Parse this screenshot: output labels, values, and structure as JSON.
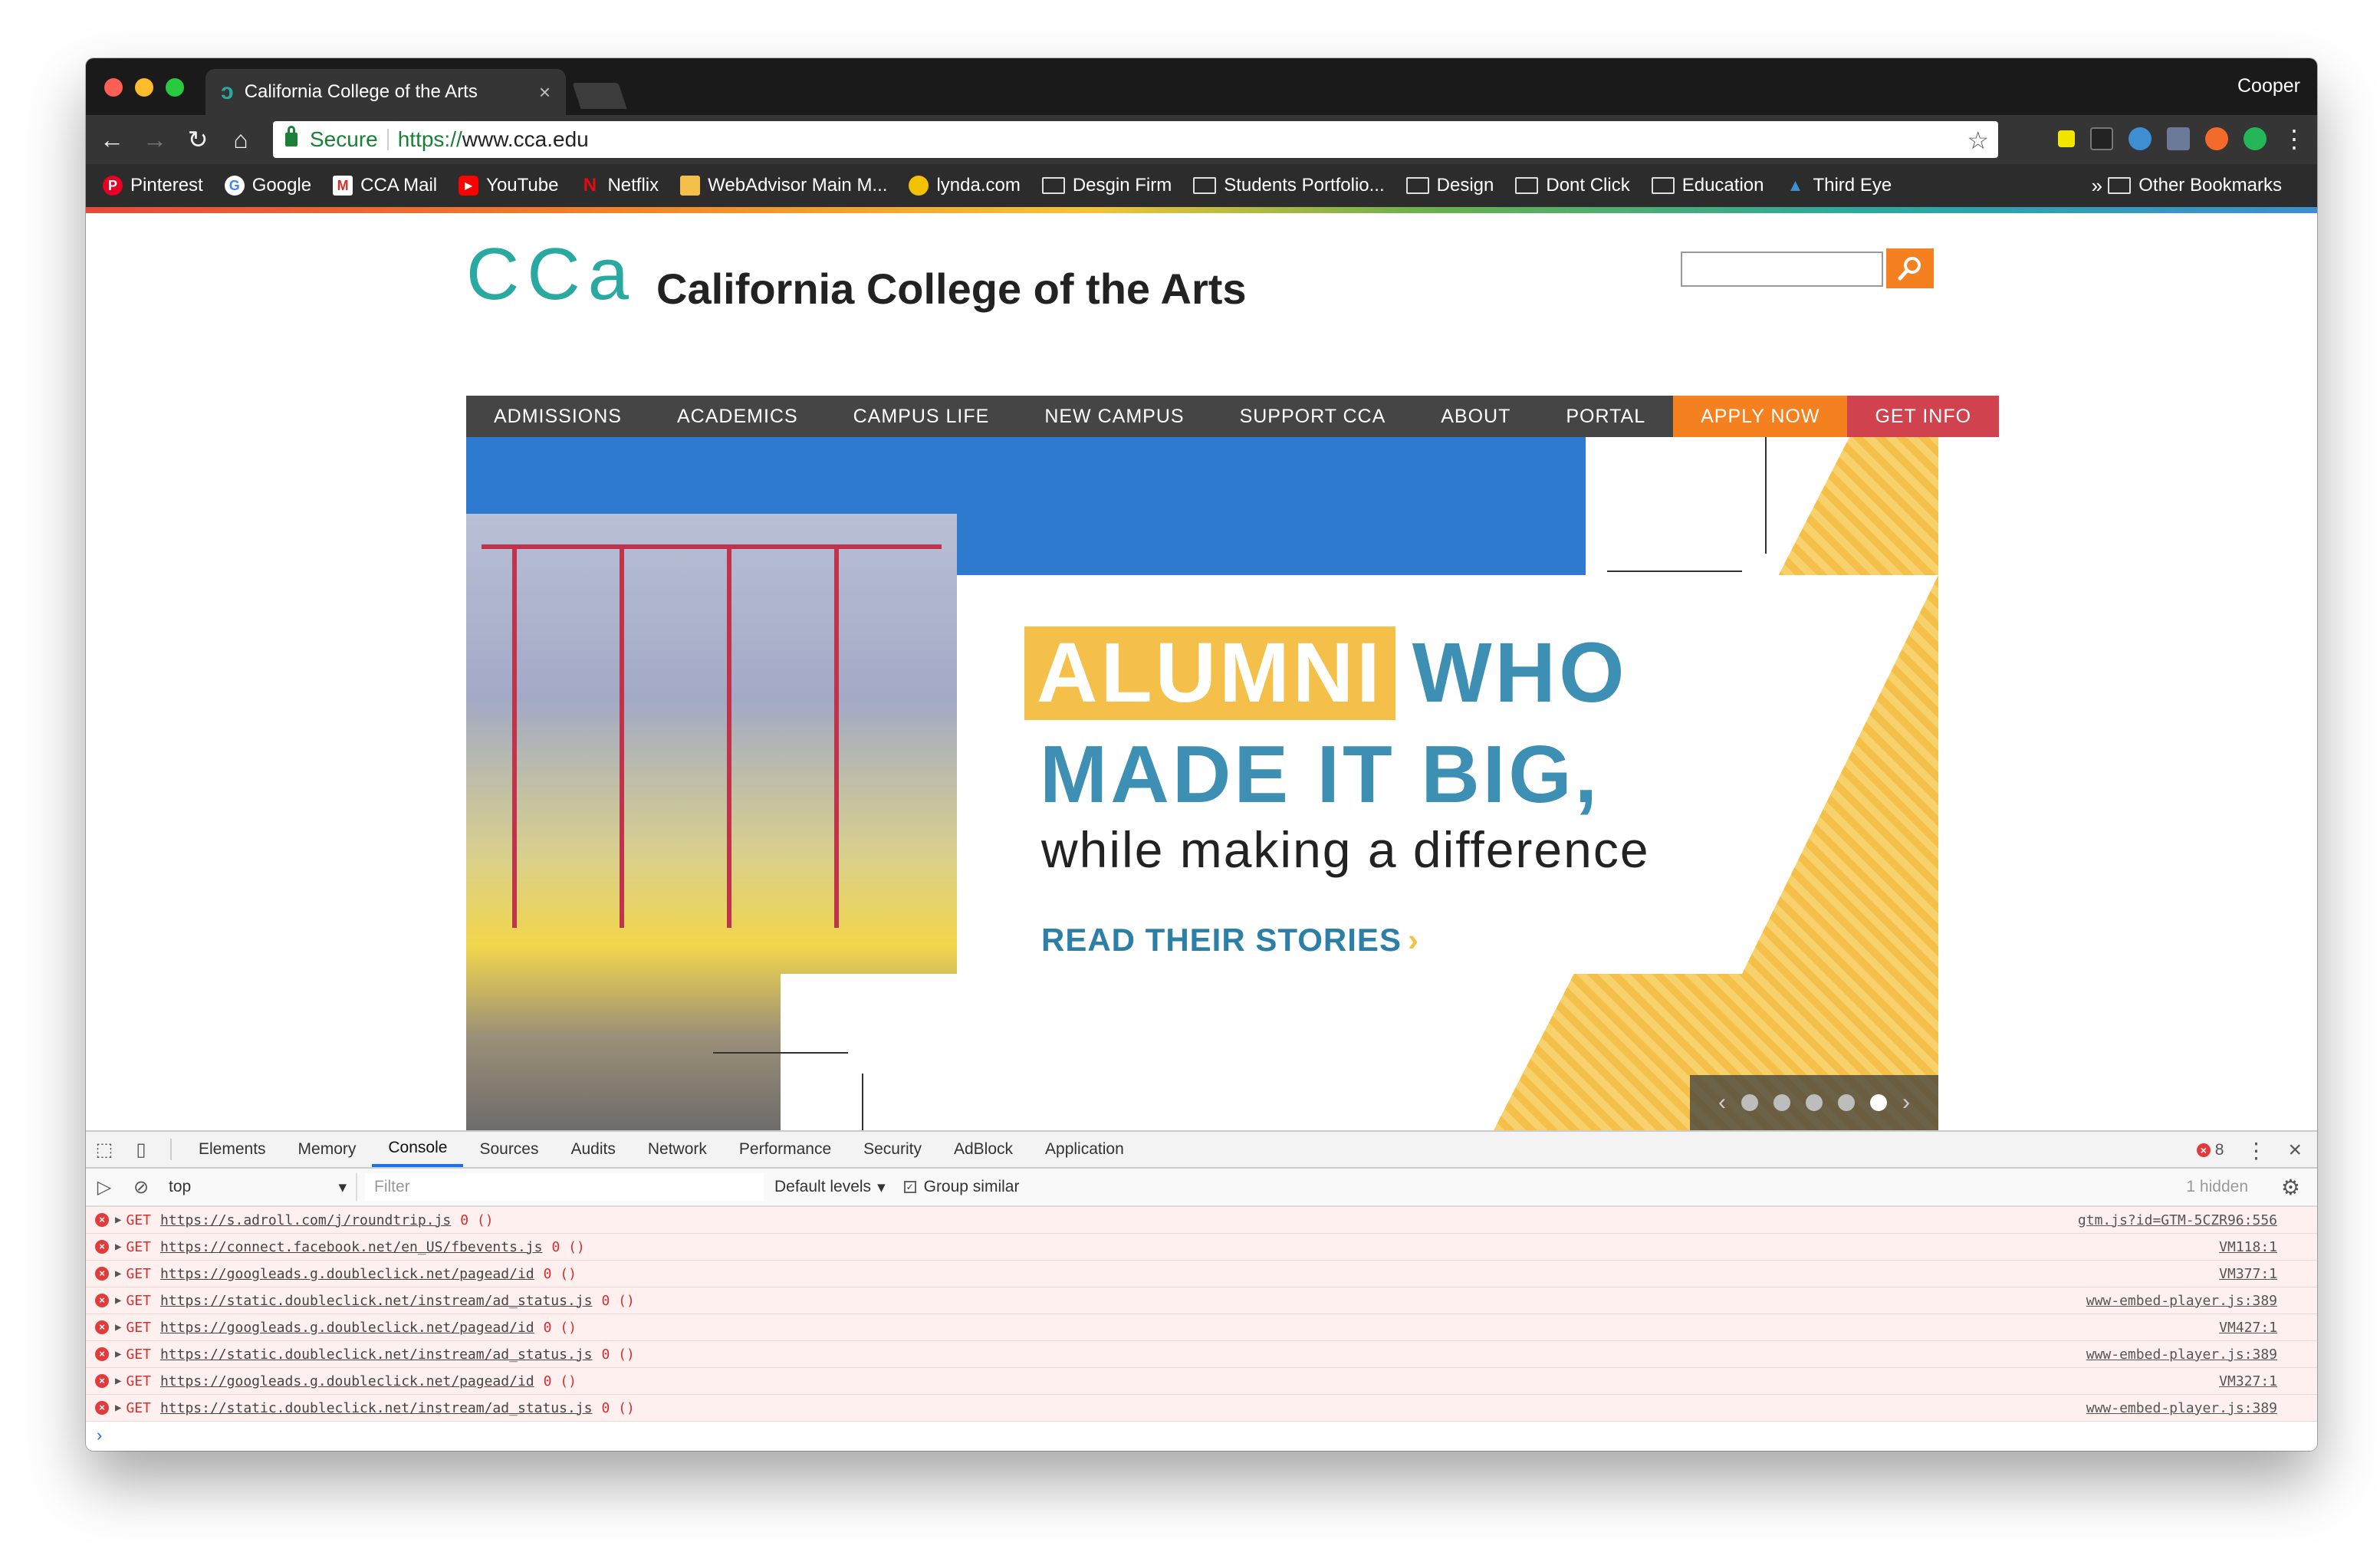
{
  "window": {
    "tab_title": "California College of the Arts",
    "tab_close": "×",
    "favicon": "ↄ",
    "profile": "Cooper"
  },
  "toolbar": {
    "back": "←",
    "forward": "→",
    "reload": "↻",
    "home": "⌂",
    "secure_label": "Secure",
    "url_scheme": "https://",
    "url_host": "www.cca.edu",
    "star": "☆",
    "menu": "⋮"
  },
  "bookmarks": {
    "items": [
      {
        "label": "Pinterest",
        "icon": "pinterest-icon",
        "color": "#e60023"
      },
      {
        "label": "Google",
        "icon": "google-icon",
        "color": "#4285f4"
      },
      {
        "label": "CCA Mail",
        "icon": "gmail-icon",
        "color": "#d93025"
      },
      {
        "label": "YouTube",
        "icon": "youtube-icon",
        "color": "#ff0000"
      },
      {
        "label": "Netflix",
        "icon": "netflix-icon",
        "color": "#e50914"
      },
      {
        "label": "WebAdvisor Main M...",
        "icon": "webadvisor-icon",
        "color": "#f5c04a"
      },
      {
        "label": "lynda.com",
        "icon": "lynda-icon",
        "color": "#f2c200"
      },
      {
        "label": "Desgin Firm",
        "icon": "folder-icon"
      },
      {
        "label": "Students Portfolio...",
        "icon": "folder-icon"
      },
      {
        "label": "Design",
        "icon": "folder-icon"
      },
      {
        "label": "Dont Click",
        "icon": "folder-icon"
      },
      {
        "label": "Education",
        "icon": "folder-icon"
      },
      {
        "label": "Third Eye",
        "icon": "third-eye-icon",
        "color": "#3d8fd1"
      }
    ],
    "overflow": "»",
    "other": "Other Bookmarks"
  },
  "site": {
    "logo": "CCa",
    "title": "California College of the Arts",
    "search_placeholder": "",
    "nav": [
      "ADMISSIONS",
      "ACADEMICS",
      "CAMPUS LIFE",
      "NEW CAMPUS",
      "SUPPORT CCA",
      "ABOUT",
      "PORTAL"
    ],
    "apply_now": "APPLY NOW",
    "get_info": "GET INFO"
  },
  "hero": {
    "alumni": "ALUMNI",
    "who": "WHO",
    "line2": "MADE IT BIG,",
    "line3": "while making a difference",
    "cta": "READ THEIR STORIES",
    "cta_chevron": "›",
    "slider_prev": "‹",
    "slider_next": "›",
    "slides": 5,
    "active_slide": 5
  },
  "devtools": {
    "tabs": [
      "Elements",
      "Memory",
      "Console",
      "Sources",
      "Audits",
      "Network",
      "Performance",
      "Security",
      "AdBlock",
      "Application"
    ],
    "active_tab": "Console",
    "error_count": "8",
    "context": "top",
    "filter_placeholder": "Filter",
    "levels": "Default levels",
    "group_similar": "Group similar",
    "hidden": "1 hidden",
    "prompt": "›",
    "rows": [
      {
        "method": "GET",
        "url": "https://s.adroll.com/j/roundtrip.js",
        "status": "0 ()",
        "source": "gtm.js?id=GTM-5CZR96:556"
      },
      {
        "method": "GET",
        "url": "https://connect.facebook.net/en_US/fbevents.js",
        "status": "0 ()",
        "source": "VM118:1"
      },
      {
        "method": "GET",
        "url": "https://googleads.g.doubleclick.net/pagead/id",
        "status": "0 ()",
        "source": "VM377:1"
      },
      {
        "method": "GET",
        "url": "https://static.doubleclick.net/instream/ad_status.js",
        "status": "0 ()",
        "source": "www-embed-player.js:389"
      },
      {
        "method": "GET",
        "url": "https://googleads.g.doubleclick.net/pagead/id",
        "status": "0 ()",
        "source": "VM427:1"
      },
      {
        "method": "GET",
        "url": "https://static.doubleclick.net/instream/ad_status.js",
        "status": "0 ()",
        "source": "www-embed-player.js:389"
      },
      {
        "method": "GET",
        "url": "https://googleads.g.doubleclick.net/pagead/id",
        "status": "0 ()",
        "source": "VM327:1"
      },
      {
        "method": "GET",
        "url": "https://static.doubleclick.net/instream/ad_status.js",
        "status": "0 ()",
        "source": "www-embed-player.js:389"
      }
    ]
  },
  "colors": {
    "accent_teal": "#2aa9a0",
    "accent_orange": "#f5801f",
    "accent_red": "#d0434e",
    "headline_blue": "#3d8fb3",
    "alumni_yellow": "#f5c04a"
  }
}
